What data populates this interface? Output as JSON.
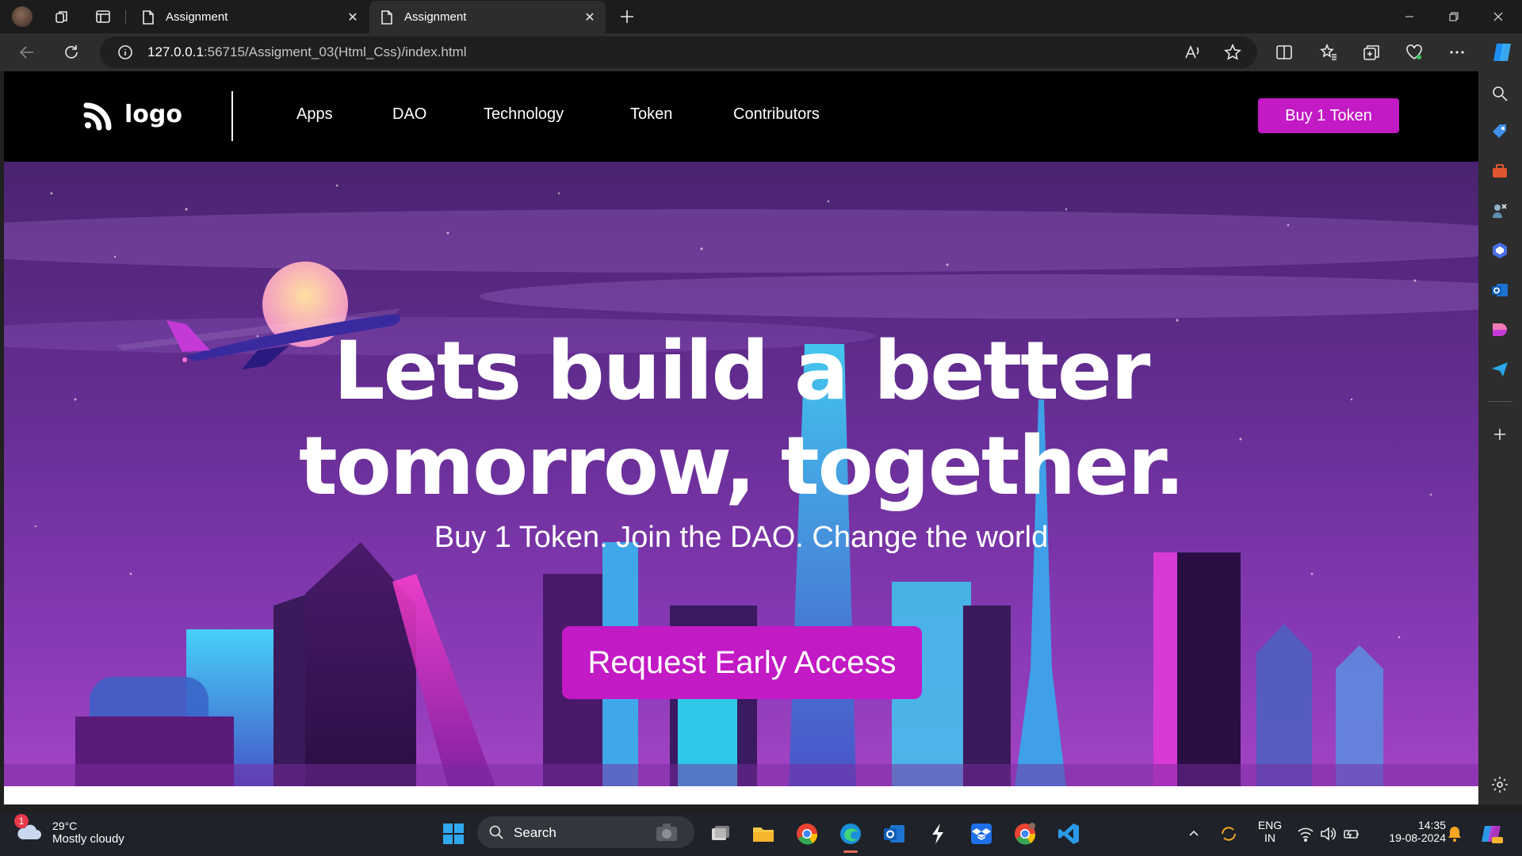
{
  "browser": {
    "tabs": [
      {
        "title": "Assignment",
        "active": false
      },
      {
        "title": "Assignment",
        "active": true
      }
    ],
    "address": {
      "host": "127.0.0.1",
      "rest": ":56715/Assigment_03(Html_Css)/index.html"
    }
  },
  "site": {
    "logo_text": "logo",
    "nav": [
      "Apps",
      "DAO",
      "Technology",
      "Token",
      "Contributors"
    ],
    "buy_button": "Buy 1 Token",
    "hero": {
      "headline_line1": "Lets build a better",
      "headline_line2": "tomorrow, together.",
      "subheadline": "Buy 1 Token. Join the DAO. Change the world",
      "cta": "Request Early Access"
    },
    "colors": {
      "accent": "#c21ac5",
      "nav_bg": "#000000"
    }
  },
  "taskbar": {
    "weather_badge": "1",
    "temperature": "29°C",
    "condition": "Mostly cloudy",
    "search_label": "Search",
    "lang_line1": "ENG",
    "lang_line2": "IN",
    "time": "14:35",
    "date": "19-08-2024"
  }
}
